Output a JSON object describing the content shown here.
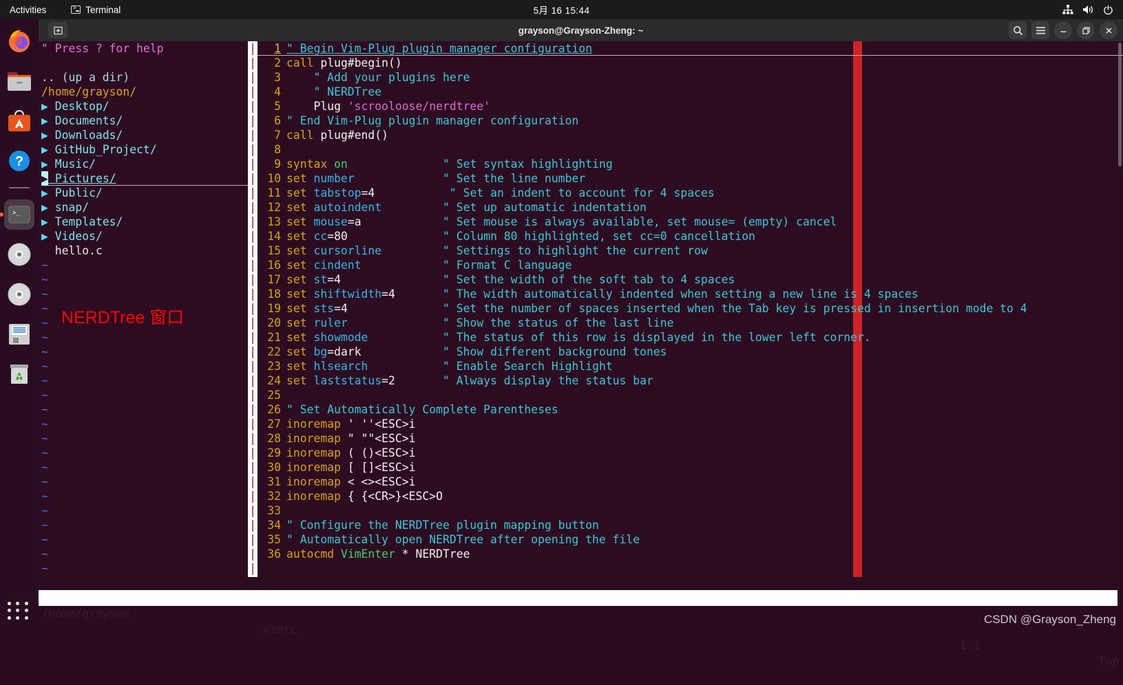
{
  "topbar": {
    "activities": "Activities",
    "app_name": "Terminal",
    "clock": "5月 16  15:44",
    "icons": [
      "network-icon",
      "volume-icon",
      "power-icon"
    ]
  },
  "window": {
    "title": "grayson@Grayson-Zheng: ~",
    "new_tab_label": "+",
    "buttons": [
      "search-icon",
      "menu-icon",
      "minimize-icon",
      "maximize-icon",
      "close-icon"
    ]
  },
  "dock": {
    "items": [
      {
        "name": "firefox",
        "label": "Firefox"
      },
      {
        "name": "files",
        "label": "Files"
      },
      {
        "name": "ubuntu-software",
        "label": "Ubuntu Software"
      },
      {
        "name": "help",
        "label": "Help"
      },
      {
        "name": "terminal",
        "label": "Terminal",
        "active": true
      },
      {
        "name": "disc-1",
        "label": "Disc"
      },
      {
        "name": "disc-2",
        "label": "Disc"
      },
      {
        "name": "disk-image",
        "label": "Disk Image"
      },
      {
        "name": "trash",
        "label": "Trash"
      }
    ],
    "show_apps_label": "Show Applications"
  },
  "nerdtree": {
    "help_hint": "\" Press ? for help",
    "up_dir": ".. (up a dir)",
    "root_path": "/home/grayson/",
    "entries": [
      {
        "arrow": "▶",
        "label": "Desktop/",
        "type": "dir"
      },
      {
        "arrow": "▶",
        "label": "Documents/",
        "type": "dir"
      },
      {
        "arrow": "▶",
        "label": "Downloads/",
        "type": "dir"
      },
      {
        "arrow": "▶",
        "label": "GitHub_Project/",
        "type": "dir"
      },
      {
        "arrow": "▶",
        "label": "Music/",
        "type": "dir"
      },
      {
        "arrow": "▶",
        "label": "Pictures/",
        "type": "dir",
        "selected": true
      },
      {
        "arrow": "▶",
        "label": "Public/",
        "type": "dir"
      },
      {
        "arrow": "▶",
        "label": "snap/",
        "type": "dir"
      },
      {
        "arrow": "▶",
        "label": "Templates/",
        "type": "dir"
      },
      {
        "arrow": "▶",
        "label": "Videos/",
        "type": "dir"
      },
      {
        "arrow": " ",
        "label": "hello.c",
        "type": "file"
      }
    ],
    "annotation": "NERDTree 窗口",
    "annotation_color": "#ff0000",
    "empty_marker": "~"
  },
  "editor": {
    "column_marker": "cc=80",
    "lines": [
      {
        "n": "1",
        "parts": [
          {
            "t": "\" Begin Vim-Plug plugin manager configuration",
            "c": "cm"
          }
        ],
        "cursorline": true
      },
      {
        "n": "2",
        "parts": [
          {
            "t": "call",
            "c": "kw"
          },
          {
            "t": " plug#begin()",
            "c": "wh"
          }
        ]
      },
      {
        "n": "3",
        "parts": [
          {
            "t": "    \" Add your plugins here",
            "c": "cm"
          }
        ]
      },
      {
        "n": "4",
        "parts": [
          {
            "t": "    \" NERDTree",
            "c": "cm"
          }
        ]
      },
      {
        "n": "5",
        "parts": [
          {
            "t": "    Plug ",
            "c": "wh"
          },
          {
            "t": "'scrooloose/nerdtree'",
            "c": "str"
          }
        ]
      },
      {
        "n": "6",
        "parts": [
          {
            "t": "\" End Vim-Plug plugin manager configuration",
            "c": "cm"
          }
        ]
      },
      {
        "n": "7",
        "parts": [
          {
            "t": "call",
            "c": "kw"
          },
          {
            "t": " plug#end()",
            "c": "wh"
          }
        ]
      },
      {
        "n": "8",
        "parts": []
      },
      {
        "n": "9",
        "parts": [
          {
            "t": "syntax",
            "c": "kw"
          },
          {
            "t": " ",
            "c": "wh"
          },
          {
            "t": "on",
            "c": "grn"
          },
          {
            "t": "              ",
            "c": "wh"
          },
          {
            "t": "\" Set syntax highlighting",
            "c": "cm"
          }
        ]
      },
      {
        "n": "10",
        "parts": [
          {
            "t": "set",
            "c": "kw"
          },
          {
            "t": " ",
            "c": "wh"
          },
          {
            "t": "number",
            "c": "opt"
          },
          {
            "t": "             ",
            "c": "wh"
          },
          {
            "t": "\" Set the line number",
            "c": "cm"
          }
        ]
      },
      {
        "n": "11",
        "parts": [
          {
            "t": "set",
            "c": "kw"
          },
          {
            "t": " ",
            "c": "wh"
          },
          {
            "t": "tabstop",
            "c": "opt"
          },
          {
            "t": "=4",
            "c": "wh"
          },
          {
            "t": "           ",
            "c": "wh"
          },
          {
            "t": "\" Set an indent to account for 4 spaces",
            "c": "cm"
          }
        ]
      },
      {
        "n": "12",
        "parts": [
          {
            "t": "set",
            "c": "kw"
          },
          {
            "t": " ",
            "c": "wh"
          },
          {
            "t": "autoindent",
            "c": "opt"
          },
          {
            "t": "         ",
            "c": "wh"
          },
          {
            "t": "\" Set up automatic indentation",
            "c": "cm"
          }
        ]
      },
      {
        "n": "13",
        "parts": [
          {
            "t": "set",
            "c": "kw"
          },
          {
            "t": " ",
            "c": "wh"
          },
          {
            "t": "mouse",
            "c": "opt"
          },
          {
            "t": "=a",
            "c": "wh"
          },
          {
            "t": "            ",
            "c": "wh"
          },
          {
            "t": "\" Set mouse is always available, set mouse= (empty) cancel",
            "c": "cm"
          }
        ]
      },
      {
        "n": "14",
        "parts": [
          {
            "t": "set",
            "c": "kw"
          },
          {
            "t": " ",
            "c": "wh"
          },
          {
            "t": "cc",
            "c": "opt"
          },
          {
            "t": "=80",
            "c": "wh"
          },
          {
            "t": "              ",
            "c": "wh"
          },
          {
            "t": "\" Column 80 highlighted, set cc=0 cancellation",
            "c": "cm"
          }
        ]
      },
      {
        "n": "15",
        "parts": [
          {
            "t": "set",
            "c": "kw"
          },
          {
            "t": " ",
            "c": "wh"
          },
          {
            "t": "cursorline",
            "c": "opt"
          },
          {
            "t": "         ",
            "c": "wh"
          },
          {
            "t": "\" Settings to highlight the current row",
            "c": "cm"
          }
        ]
      },
      {
        "n": "16",
        "parts": [
          {
            "t": "set",
            "c": "kw"
          },
          {
            "t": " ",
            "c": "wh"
          },
          {
            "t": "cindent",
            "c": "opt"
          },
          {
            "t": "            ",
            "c": "wh"
          },
          {
            "t": "\" Format C language",
            "c": "cm"
          }
        ]
      },
      {
        "n": "17",
        "parts": [
          {
            "t": "set",
            "c": "kw"
          },
          {
            "t": " ",
            "c": "wh"
          },
          {
            "t": "st",
            "c": "opt"
          },
          {
            "t": "=4",
            "c": "wh"
          },
          {
            "t": "               ",
            "c": "wh"
          },
          {
            "t": "\" Set the width of the soft tab to 4 spaces",
            "c": "cm"
          }
        ]
      },
      {
        "n": "18",
        "parts": [
          {
            "t": "set",
            "c": "kw"
          },
          {
            "t": " ",
            "c": "wh"
          },
          {
            "t": "shiftwidth",
            "c": "opt"
          },
          {
            "t": "=4",
            "c": "wh"
          },
          {
            "t": "       ",
            "c": "wh"
          },
          {
            "t": "\" The width automatically indented when setting a new line is 4 spaces",
            "c": "cm"
          }
        ]
      },
      {
        "n": "19",
        "parts": [
          {
            "t": "set",
            "c": "kw"
          },
          {
            "t": " ",
            "c": "wh"
          },
          {
            "t": "sts",
            "c": "opt"
          },
          {
            "t": "=4",
            "c": "wh"
          },
          {
            "t": "              ",
            "c": "wh"
          },
          {
            "t": "\" Set the number of spaces inserted when the Tab key is pressed in insertion mode to 4",
            "c": "cm"
          }
        ]
      },
      {
        "n": "20",
        "parts": [
          {
            "t": "set",
            "c": "kw"
          },
          {
            "t": " ",
            "c": "wh"
          },
          {
            "t": "ruler",
            "c": "opt"
          },
          {
            "t": "              ",
            "c": "wh"
          },
          {
            "t": "\" Show the status of the last line",
            "c": "cm"
          }
        ]
      },
      {
        "n": "21",
        "parts": [
          {
            "t": "set",
            "c": "kw"
          },
          {
            "t": " ",
            "c": "wh"
          },
          {
            "t": "showmode",
            "c": "opt"
          },
          {
            "t": "           ",
            "c": "wh"
          },
          {
            "t": "\" The status of this row is displayed in the lower left corner.",
            "c": "cm"
          }
        ]
      },
      {
        "n": "22",
        "parts": [
          {
            "t": "set",
            "c": "kw"
          },
          {
            "t": " ",
            "c": "wh"
          },
          {
            "t": "bg",
            "c": "opt"
          },
          {
            "t": "=dark",
            "c": "wh"
          },
          {
            "t": "            ",
            "c": "wh"
          },
          {
            "t": "\" Show different background tones",
            "c": "cm"
          }
        ]
      },
      {
        "n": "23",
        "parts": [
          {
            "t": "set",
            "c": "kw"
          },
          {
            "t": " ",
            "c": "wh"
          },
          {
            "t": "hlsearch",
            "c": "opt"
          },
          {
            "t": "           ",
            "c": "wh"
          },
          {
            "t": "\" Enable Search Highlight",
            "c": "cm"
          }
        ]
      },
      {
        "n": "24",
        "parts": [
          {
            "t": "set",
            "c": "kw"
          },
          {
            "t": " ",
            "c": "wh"
          },
          {
            "t": "laststatus",
            "c": "opt"
          },
          {
            "t": "=2",
            "c": "wh"
          },
          {
            "t": "       ",
            "c": "wh"
          },
          {
            "t": "\" Always display the status bar",
            "c": "cm"
          }
        ]
      },
      {
        "n": "25",
        "parts": []
      },
      {
        "n": "26",
        "parts": [
          {
            "t": "\" Set Automatically Complete Parentheses",
            "c": "cm"
          }
        ]
      },
      {
        "n": "27",
        "parts": [
          {
            "t": "inoremap",
            "c": "kw"
          },
          {
            "t": " ' ''<ESC>i",
            "c": "wh"
          }
        ]
      },
      {
        "n": "28",
        "parts": [
          {
            "t": "inoremap",
            "c": "kw"
          },
          {
            "t": " \" \"\"<ESC>i",
            "c": "wh"
          }
        ]
      },
      {
        "n": "29",
        "parts": [
          {
            "t": "inoremap",
            "c": "kw"
          },
          {
            "t": " ( ()<ESC>i",
            "c": "wh"
          }
        ]
      },
      {
        "n": "30",
        "parts": [
          {
            "t": "inoremap",
            "c": "kw"
          },
          {
            "t": " [ []<ESC>i",
            "c": "wh"
          }
        ]
      },
      {
        "n": "31",
        "parts": [
          {
            "t": "inoremap",
            "c": "kw"
          },
          {
            "t": " < <><ESC>i",
            "c": "wh"
          }
        ]
      },
      {
        "n": "32",
        "parts": [
          {
            "t": "inoremap",
            "c": "kw"
          },
          {
            "t": " { {<CR>}<ESC>O",
            "c": "wh"
          }
        ]
      },
      {
        "n": "33",
        "parts": []
      },
      {
        "n": "34",
        "parts": [
          {
            "t": "\" Configure the NERDTree plugin mapping button",
            "c": "cm"
          }
        ]
      },
      {
        "n": "35",
        "parts": [
          {
            "t": "\" Automatically open NERDTree after opening the file",
            "c": "cm"
          }
        ]
      },
      {
        "n": "36",
        "parts": [
          {
            "t": "autocmd",
            "c": "kw"
          },
          {
            "t": " ",
            "c": "wh"
          },
          {
            "t": "VimEnter",
            "c": "grn"
          },
          {
            "t": " * NERDTree",
            "c": "wh"
          }
        ]
      }
    ]
  },
  "statusline": {
    "left": "/home/grayson",
    "file": ".vimrc",
    "position": "1,1",
    "scroll": "Top"
  },
  "watermark": "CSDN @Grayson_Zheng"
}
